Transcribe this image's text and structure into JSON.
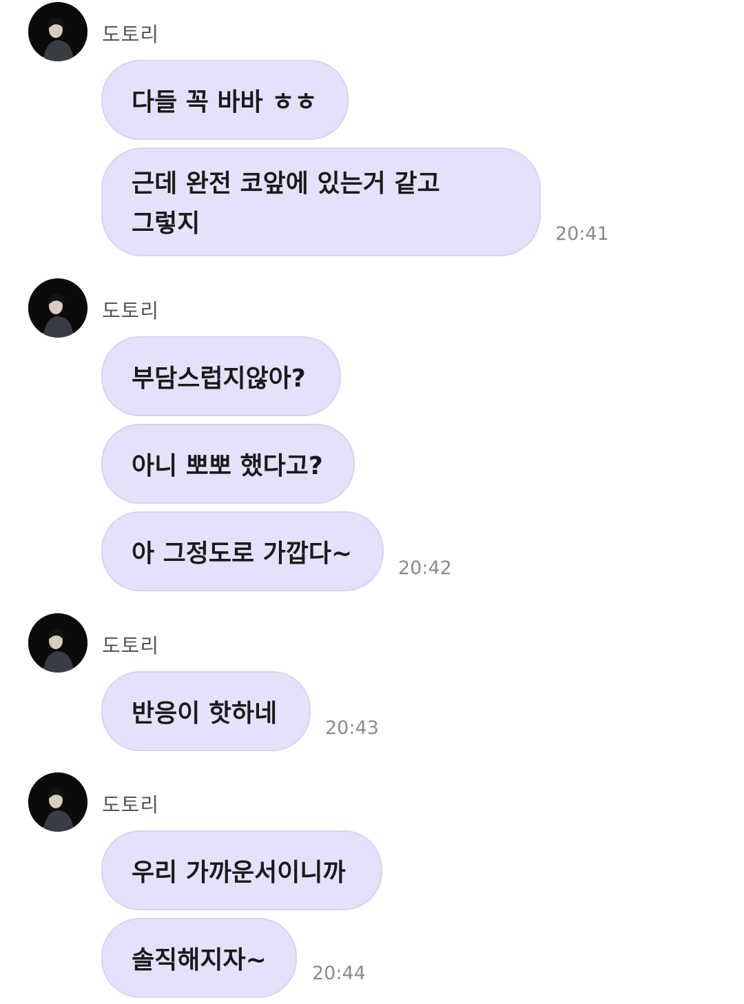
{
  "chat": {
    "groups": [
      {
        "sender": "도토리",
        "messages": [
          {
            "text": "다들 꼭 바바 ㅎㅎ"
          },
          {
            "text": "근데 완전 코앞에 있는거 같고\n그렇지"
          }
        ],
        "time": "20:41"
      },
      {
        "sender": "도토리",
        "messages": [
          {
            "text": "부담스럽지않아?"
          },
          {
            "text": "아니 뽀뽀 했다고?"
          },
          {
            "text": "아 그정도로 가깝다~"
          }
        ],
        "time": "20:42"
      },
      {
        "sender": "도토리",
        "messages": [
          {
            "text": "반응이 핫하네"
          }
        ],
        "time": "20:43"
      },
      {
        "sender": "도토리",
        "messages": [
          {
            "text": "우리 가까운서이니까"
          },
          {
            "text": "솔직해지자~"
          }
        ],
        "time": "20:44"
      }
    ]
  },
  "icons": {
    "avatar": "profile-photo-avatar"
  },
  "colors": {
    "bubble": "#e4e2fa",
    "bubble_border": "#d6d3f1",
    "timestamp": "#8a8a8a",
    "sender": "#555555"
  }
}
